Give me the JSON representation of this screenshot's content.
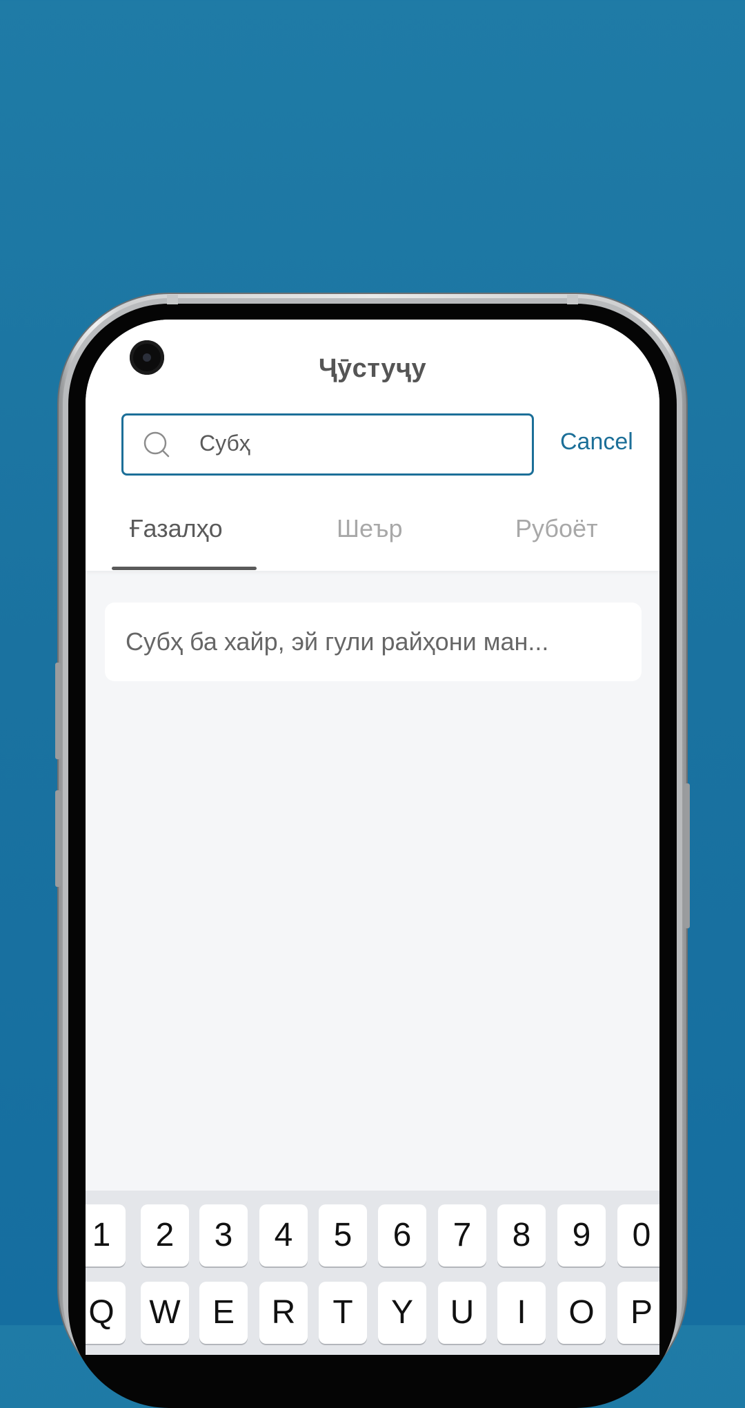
{
  "header": {
    "title": "Ҷӯстуҷу"
  },
  "search": {
    "value": "Субҳ",
    "cancel_label": "Cancel"
  },
  "tabs": [
    {
      "label": "Ғазалҳо",
      "active": true
    },
    {
      "label": "Шеър",
      "active": false
    },
    {
      "label": "Рубоёт",
      "active": false
    }
  ],
  "results": [
    {
      "text": "Субҳ ба хайр, эй гули райҳони ман..."
    }
  ],
  "keyboard": {
    "row1": [
      "1",
      "2",
      "3",
      "4",
      "5",
      "6",
      "7",
      "8",
      "9",
      "0"
    ],
    "row2": [
      "Q",
      "W",
      "E",
      "R",
      "T",
      "Y",
      "U",
      "I",
      "O",
      "P"
    ]
  },
  "colors": {
    "background": "#1a74a2",
    "accent": "#1c6f98",
    "active_tab": "#5a5a5a",
    "inactive_tab": "#a8a8a8"
  }
}
